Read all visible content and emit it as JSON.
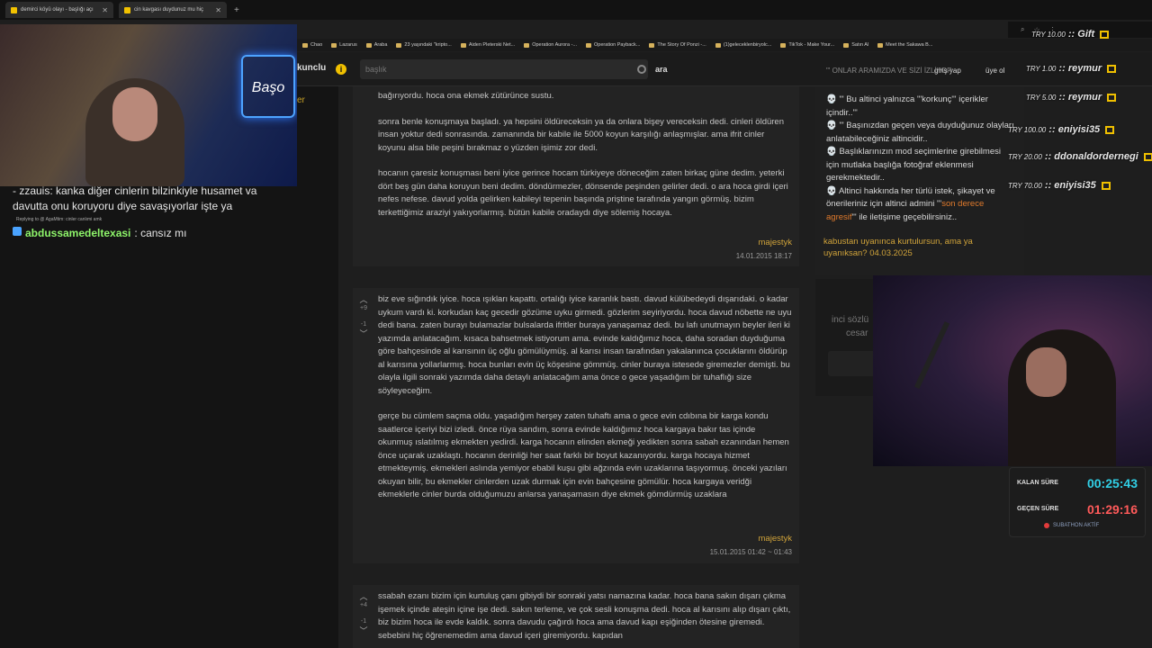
{
  "browser": {
    "tabs": [
      {
        "label": "demirci köyü olayı - başlığı açı"
      },
      {
        "label": "cin kavgası duydunuz mu hiç"
      }
    ],
    "bookmarks": [
      "Chao",
      "Lazarus",
      "Araba",
      "23 yaşındaki \"kripto...",
      "Aiden Pleterski Net...",
      "Operation Aurora -...",
      "Operation Payback...",
      "The Story Of Ponzi -...",
      "(1)geleceklenbiryolc...",
      "TikTok - Make Your...",
      "Satın Al",
      "Meet the Sakawa B..."
    ]
  },
  "site": {
    "logo_text": "kunclu",
    "search_placeholder": "başlık",
    "search_button": "ara",
    "login": "giriş yap",
    "register": "üye ol",
    "left_hint": "er"
  },
  "chat": {
    "line1": "- zzauis: kanka diğer cinlerin bilzinkiyle husamet va",
    "line2": "davutta onu koruyoru diye savaşıyorlar işte ya",
    "reply_hint": "Replying to @ AgaMtim: cinler canlımi amk",
    "user": "abdussamedeltexasi",
    "message": ": cansız mı"
  },
  "entries": [
    {
      "paragraphs": [
        "bağırıyordu. hoca ona ekmek zütürünce sustu.",
        "sonra benle konuşmaya başladı. ya hepsini öldüreceksin ya da onlara bişey vereceksin dedi. cinleri öldüren insan yoktur dedi sonrasında. zamanında bir kabile ile 5000 koyun karşılığı anlaşmışlar. ama ifrit cinler koyunu alsa bile peşini bırakmaz o yüzden işimiz zor dedi.",
        "hocanın çaresiz konuşması beni iyice gerince hocam türkiyeye döneceğim zaten birkaç güne dedim. yeterki dört beş gün daha koruyun beni dedim. döndürmezler, dönsende peşinden gelirler dedi. o ara hoca girdi içeri nefes nefese. davud yolda gelirken kabileyi tepenin başında priştine tarafında yangın görmüş. bizim terkettiğimiz araziyi yakıyorlarmış. bütün kabile oradaydı diye sölemiş hocaya."
      ],
      "author": "majestyk",
      "date": "14.01.2015 18:17"
    },
    {
      "up": "+9",
      "down": "-1",
      "paragraphs": [
        "biz eve sığındık iyice. hoca ışıkları kapattı. ortalığı iyice karanlık bastı. davud külübedeydi dışarıdaki. o kadar uykum vardı ki. korkudan kaç gecedir gözüme uyku girmedi. gözlerim seyiriyordu. hoca davud nöbette ne uyu dedi bana. zaten burayı bulamazlar bulsalarda ifritler buraya yanaşamaz dedi. bu lafı unutmayın beyler ileri ki yazımda anlatacağım. kısaca bahsetmek istiyorum ama. evinde kaldığımız hoca, daha soradan duyduğuma göre bahçesinde al karısının üç oğlu gömülüymüş. al karısı insan tarafından yakalanınca çocuklarını öldürüp al karısına yollarlarmış. hoca bunları evin üç köşesine gömmüş. cinler buraya istesede giremezler demişti. bu olayla ilgili sonraki yazımda daha detaylı anlatacağım ama önce o gece yaşadığım bir tuhaflığı size söyleyeceğim.",
        "gerçe bu cümlem saçma oldu. yaşadığım herşey zaten tuhaftı ama o gece evin cdıbına bir karga kondu saatlerce içeriyi bizi izledi. önce rüya sandım, sonra evinde kaldığımız hoca kargaya bakır tas içinde okunmuş ıslatılmış ekmekten yedirdi. karga hocanın elinden ekmeği yedikten sonra sabah ezanından hemen önce uçarak uzaklaştı. hocanın derinliği her saat farklı bir boyut kazanıyordu. karga hocaya hizmet etmekteymiş. ekmekleri aslında yemiyor ebabil kuşu gibi ağzında evin uzaklarına taşıyormuş. önceki yazıları okuyan bilir, bu ekmekler cinlerden uzak durmak için evin bahçesine gömülür. hoca kargaya veridği ekmeklerle cinler burda olduğumuzu anlarsa yanaşamasın diye ekmek gömdürmüş uzaklara"
      ],
      "author": "majestyk",
      "date": "15.01.2015 01:42 ~ 01:43"
    },
    {
      "up": "+4",
      "down": "-1",
      "paragraphs": [
        "ssabah ezanı bizim için kurtuluş çanı gibiydi bir sonraki yatsı namazına kadar. hoca bana sakın dışarı çıkma işemek içinde ateşin içine işe dedi. sakın terleme, ve çok sesli konuşma dedi. hoca al karısını alıp dışarı çıktı, biz bizim hoca ile evde kaldık. sonra davudu çağırdı hoca ama davud kapı eşiğinden ötesine giremedi. sebebini hiç öğrenemedim ama davud içeri giremiyordu. kapıdan"
      ]
    }
  ],
  "sidebar": {
    "header": "\"' ONLAR ARAMIZDA VE SİZİ İZLİYOR",
    "rules": [
      {
        "pre": "\"' Bu altinci yalnızca \"'korkunç\"' içerikler içindir..\"'",
        "hl": "",
        "post": ""
      },
      {
        "pre": "\"' Başınızdan geçen veya duyduğunuz olayları anlatabileceğiniz altincidir..",
        "hl": "",
        "post": ""
      },
      {
        "pre": "Başlıklarınızın mod seçimlerine girebilmesi için mutlaka başlığa fotoğraf eklenmesi gerekmektedir..",
        "hl": "",
        "post": ""
      },
      {
        "pre": "Altinci hakkında her türlü istek, şikayet ve önerileriniz için altinci admini \"'",
        "hl": "son derece agresif",
        "post": "\"' ile iletişime geçebilirsiniz.."
      }
    ],
    "motd": "kabustan uyanınca kurtulursun, ama ya uyanıksan? 04.03.2025",
    "box_text1": "inci sözlü",
    "box_text2": "cesar"
  },
  "donations": [
    {
      "amount": "TRY 10.00",
      "name": "Gift"
    },
    {
      "amount": "TRY 1.00",
      "name": "reymur"
    },
    {
      "amount": "TRY 5.00",
      "name": "reymur"
    },
    {
      "amount": "TRY 100.00",
      "name": "eniyisi35"
    },
    {
      "amount": "TRY 20.00",
      "name": "ddonaldordernegi"
    },
    {
      "amount": "TRY 70.00",
      "name": "eniyisi35"
    }
  ],
  "timer": {
    "remaining_label": "KALAN SÜRE",
    "remaining_value": "00:25:43",
    "elapsed_label": "GEÇEN SÜRE",
    "elapsed_value": "01:29:16",
    "status": "SUBATHON AKTİF"
  },
  "overlay": {
    "neon_sign": "Başo"
  },
  "colors": {
    "accent": "#d0a33a",
    "timer_cyan": "#31d0e6",
    "timer_red": "#ff5a5a"
  }
}
